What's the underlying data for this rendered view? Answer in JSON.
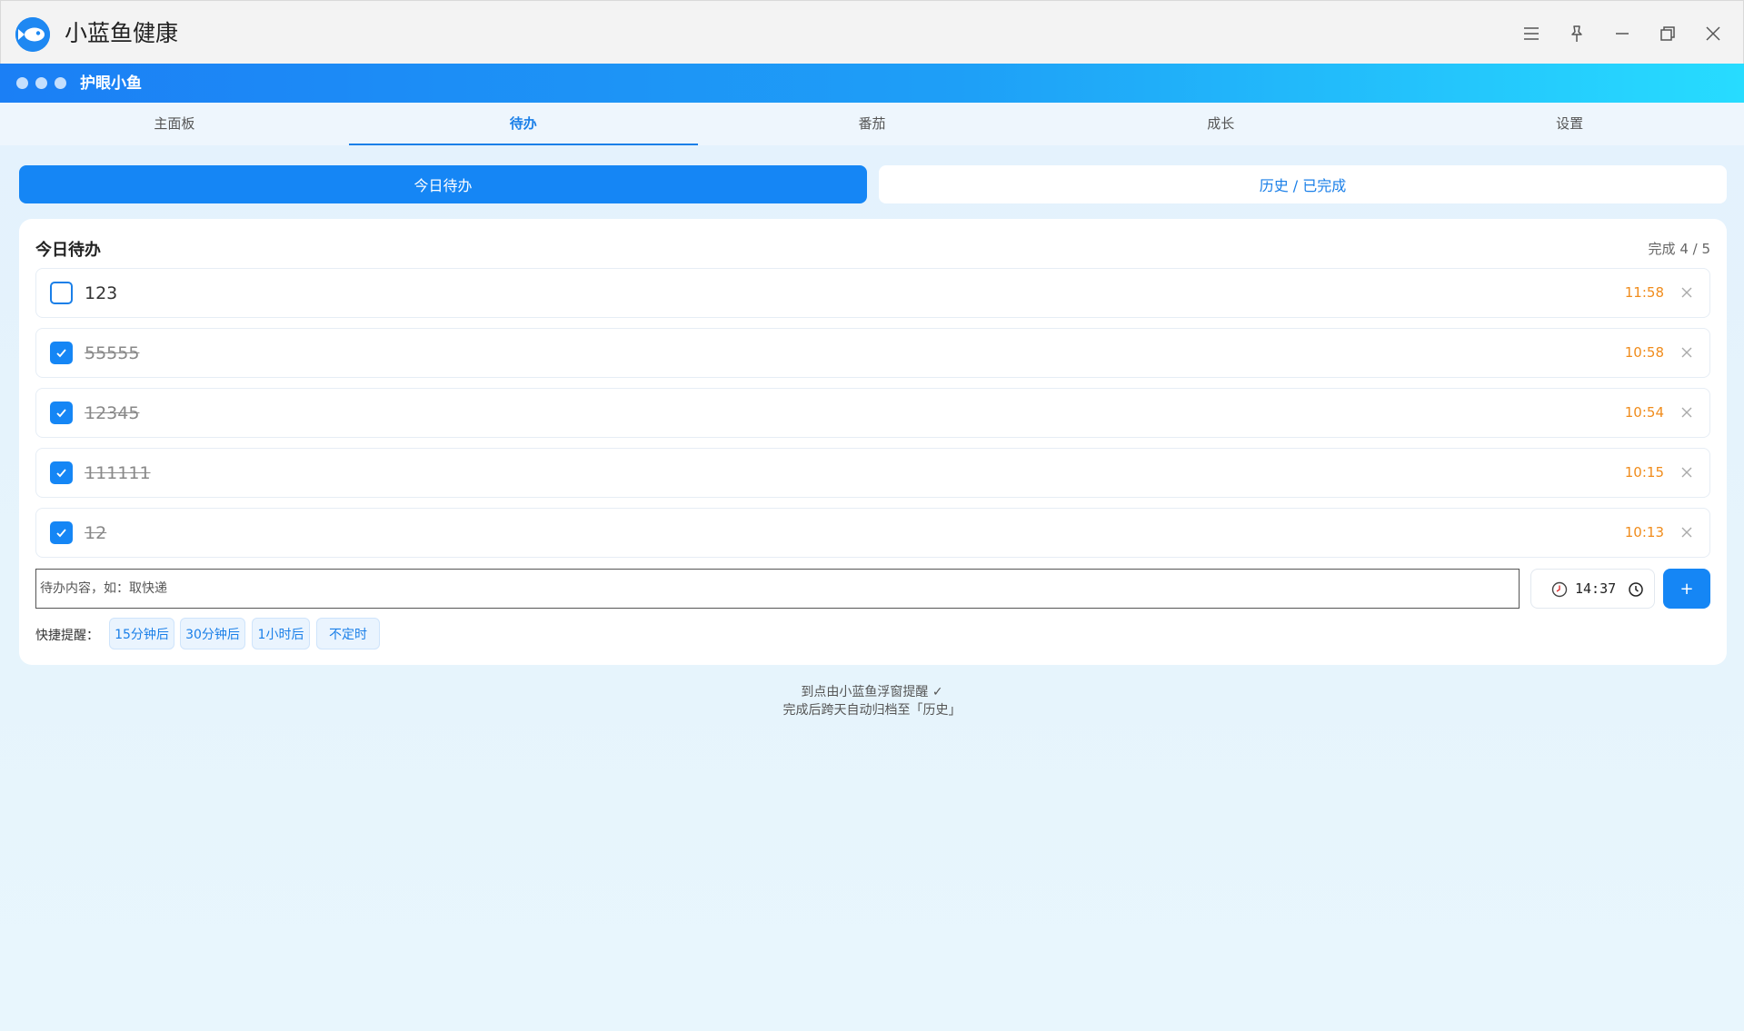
{
  "window": {
    "title": "小蓝鱼健康",
    "logo_icon": "fish-logo-icon"
  },
  "header": {
    "title": "护眼小鱼"
  },
  "tabs": [
    {
      "label": "主面板",
      "active": false
    },
    {
      "label": "待办",
      "active": true
    },
    {
      "label": "番茄",
      "active": false
    },
    {
      "label": "成长",
      "active": false
    },
    {
      "label": "设置",
      "active": false
    }
  ],
  "segments": {
    "today": "今日待办",
    "history": "历史 / 已完成"
  },
  "card": {
    "title": "今日待办",
    "count": "完成 4 / 5"
  },
  "todos": [
    {
      "text": "123",
      "time": "11:58",
      "done": false
    },
    {
      "text": "55555",
      "time": "10:58",
      "done": true
    },
    {
      "text": "12345",
      "time": "10:54",
      "done": true
    },
    {
      "text": "111111",
      "time": "10:15",
      "done": true
    },
    {
      "text": "12",
      "time": "10:13",
      "done": true
    }
  ],
  "new_todo": {
    "placeholder": "待办内容，如：取快递",
    "time": "14:37",
    "add_label": "+"
  },
  "quick": {
    "label": "快捷提醒：",
    "chips": [
      "15分钟后",
      "30分钟后",
      "1小时后",
      "不定时"
    ]
  },
  "footer": {
    "line1": "到点由小蓝鱼浮窗提醒 ✓",
    "line2": "完成后跨天自动归档至「历史」"
  },
  "colors": {
    "accent": "#1586f5",
    "time": "#f08c1c"
  }
}
